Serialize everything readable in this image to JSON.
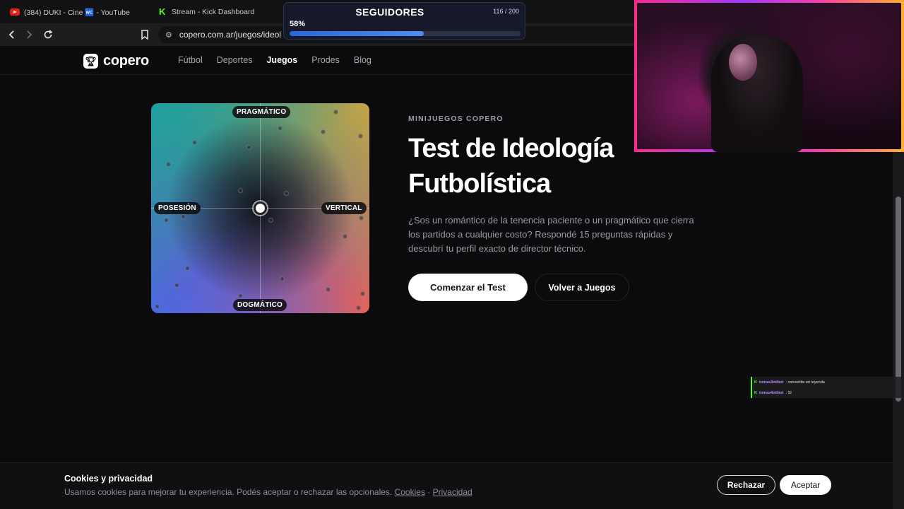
{
  "browser": {
    "tabs": [
      {
        "title": "(384) DUKI - Cine 🚾 - YouTube",
        "icon": "youtube-icon"
      },
      {
        "title": "Stream - Kick Dashboard",
        "icon": "kick-icon"
      }
    ],
    "url": "copero.com.ar/juegos/ideol"
  },
  "overlay": {
    "followers": {
      "title": "SEGUIDORES",
      "count": "116 / 200",
      "percent_label": "58%",
      "progress": 0.58
    },
    "chat": [
      {
        "user": "tomas4ntibot",
        "message": ": convertite en leyenda"
      },
      {
        "user": "tomas4ntibot",
        "message": ": SI"
      }
    ]
  },
  "site": {
    "brand": "copero",
    "nav": [
      "Fútbol",
      "Deportes",
      "Juegos",
      "Prodes",
      "Blog"
    ],
    "active_nav": "Juegos",
    "compass": {
      "top": "PRAGMÁTICO",
      "bottom": "DOGMÁTICO",
      "left": "POSESIÓN",
      "right": "VERTICAL"
    },
    "eyebrow": "MINIJUEGOS COPERO",
    "title": "Test de Ideología Futbolística",
    "description": "¿Sos un romántico de la tenencia paciente o un pragmático que cierra los partidos a cualquier costo? Respondé 15 preguntas rápidas y descubrí tu perfil exacto de director técnico.",
    "primary_button": "Comenzar el Test",
    "secondary_button": "Volver a Juegos"
  },
  "cookies": {
    "title": "Cookies y privacidad",
    "text": "Usamos cookies para mejorar tu experiencia. Podés aceptar o rechazar las opcionales.",
    "link_cookies": "Cookies",
    "separator": "·",
    "link_privacy": "Privacidad",
    "reject": "Rechazar",
    "accept": "Aceptar"
  }
}
